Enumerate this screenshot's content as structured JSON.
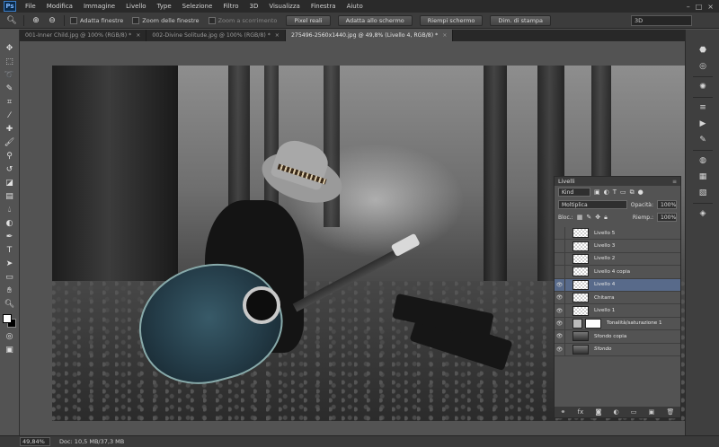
{
  "app": {
    "logo": "Ps"
  },
  "menu": [
    "File",
    "Modifica",
    "Immagine",
    "Livello",
    "Type",
    "Selezione",
    "Filtro",
    "3D",
    "Visualizza",
    "Finestra",
    "Aiuto"
  ],
  "window_controls": {
    "minimize": "–",
    "maximize": "□",
    "close": "×"
  },
  "options": {
    "resize_windows_label": "Adatta finestre",
    "zoom_all_label": "Zoom delle finestre",
    "scrubby_zoom_label": "Zoom a scorrimento",
    "actual_pixels_button": "Pixel reali",
    "fit_screen_button": "Adatta allo schermo",
    "fill_screen_button": "Riempi schermo",
    "print_size_button": "Dim. di stampa",
    "workspace_value": "3D"
  },
  "doc_tabs": [
    {
      "label": "001-Inner Child.jpg @ 100% (RGB/8) *",
      "active": false
    },
    {
      "label": "002-Divine Solitude.jpg @ 100% (RGB/8) *",
      "active": false
    },
    {
      "label": "275496-2560x1440.jpg @ 49,8% (Livello 4, RGB/8) *",
      "active": true
    }
  ],
  "layers_panel": {
    "title": "Livelli",
    "kind_label": "Kind",
    "blend_mode": "Moltiplica",
    "opacity_label": "Opacità:",
    "opacity_value": "100%",
    "lock_label": "Bloc.:",
    "fill_label": "Riemp.:",
    "fill_value": "100%",
    "layers": [
      {
        "name": "Livello 5",
        "visible": false,
        "active": false,
        "thumb": "transparent"
      },
      {
        "name": "Livello 3",
        "visible": false,
        "active": false,
        "thumb": "transparent"
      },
      {
        "name": "Livello 2",
        "visible": false,
        "active": false,
        "thumb": "transparent"
      },
      {
        "name": "Livello 4 copia",
        "visible": false,
        "active": false,
        "thumb": "transparent"
      },
      {
        "name": "Livello 4",
        "visible": true,
        "active": true,
        "thumb": "transparent"
      },
      {
        "name": "Chitarra",
        "visible": true,
        "active": false,
        "thumb": "transparent"
      },
      {
        "name": "Livello 1",
        "visible": true,
        "active": false,
        "thumb": "transparent"
      },
      {
        "name": "Tonalità/saturazione 1",
        "visible": true,
        "active": false,
        "thumb": "adjustment"
      },
      {
        "name": "Sfondo copia",
        "visible": true,
        "active": false,
        "thumb": "photo"
      },
      {
        "name": "Sfondo",
        "visible": true,
        "active": false,
        "thumb": "photo",
        "italic": true
      }
    ]
  },
  "status": {
    "zoom": "49,84%",
    "doc_info": "Doc: 10,5 MB/37,3 MB"
  },
  "colors": {
    "accent": "#586a8a",
    "panel": "#535353",
    "dark": "#2a2a2a"
  }
}
